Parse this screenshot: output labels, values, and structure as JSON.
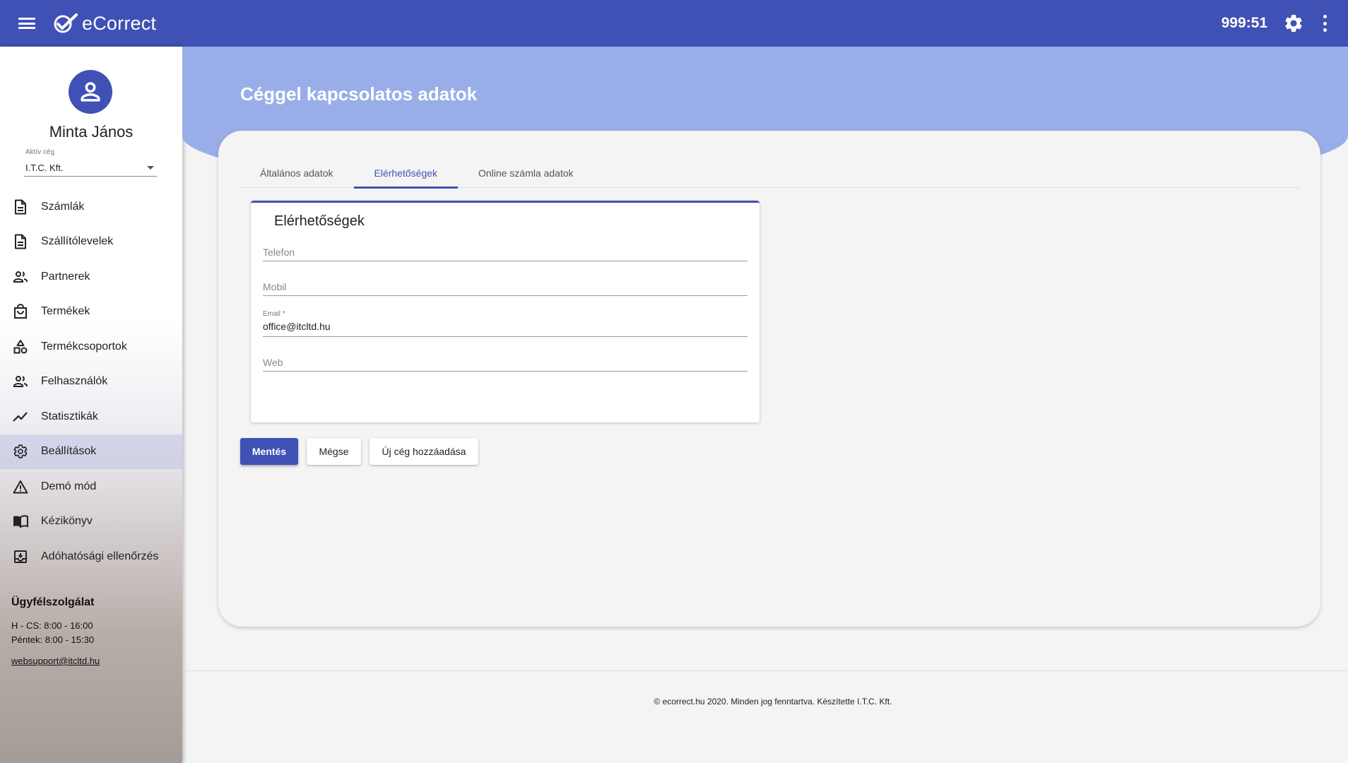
{
  "header": {
    "app_name": "eCorrect",
    "timer": "999:51"
  },
  "sidebar": {
    "user_name": "Minta János",
    "company_label": "Aktív cég",
    "company_value": "I.T.C. Kft.",
    "items": [
      {
        "label": "Számlák",
        "icon": "document-icon"
      },
      {
        "label": "Szállítólevelek",
        "icon": "document-icon"
      },
      {
        "label": "Partnerek",
        "icon": "people-icon"
      },
      {
        "label": "Termékek",
        "icon": "shopping-bag-icon"
      },
      {
        "label": "Termékcsoportok",
        "icon": "category-icon"
      },
      {
        "label": "Felhasználók",
        "icon": "people-icon"
      },
      {
        "label": "Statisztikák",
        "icon": "trending-up-icon"
      },
      {
        "label": "Beállítások",
        "icon": "gear-icon"
      },
      {
        "label": "Demó mód",
        "icon": "warning-icon"
      },
      {
        "label": "Kézikönyv",
        "icon": "book-icon"
      },
      {
        "label": "Adóhatósági ellenőrzés",
        "icon": "archive-icon"
      }
    ],
    "active_index": 7,
    "support": {
      "title": "Ügyfélszolgálat",
      "hours_1": "H - CS: 8:00 - 16:00",
      "hours_2": "Péntek: 8:00 - 15:30",
      "email": "websupport@itcltd.hu"
    }
  },
  "main": {
    "page_title": "Céggel kapcsolatos adatok",
    "tabs": [
      {
        "label": "Általános adatok"
      },
      {
        "label": "Elérhetőségek"
      },
      {
        "label": "Online számla adatok"
      }
    ],
    "active_tab": 1,
    "form": {
      "title": "Elérhetőségek",
      "fields": {
        "phone": {
          "placeholder": "Telefon",
          "value": ""
        },
        "mobile": {
          "placeholder": "Mobil",
          "value": ""
        },
        "email": {
          "label": "Email *",
          "value": "office@itcltd.hu"
        },
        "web": {
          "placeholder": "Web",
          "value": ""
        }
      }
    },
    "buttons": {
      "save": "Mentés",
      "cancel": "Mégse",
      "new_company": "Új cég hozzáadása"
    }
  },
  "footer": {
    "text": "© ecorrect.hu 2020. Minden jog fenntartva. Készítette I.T.C. Kft."
  },
  "colors": {
    "primary": "#3f51b5",
    "hero": "#99aee8",
    "background": "#f4f4f4"
  }
}
